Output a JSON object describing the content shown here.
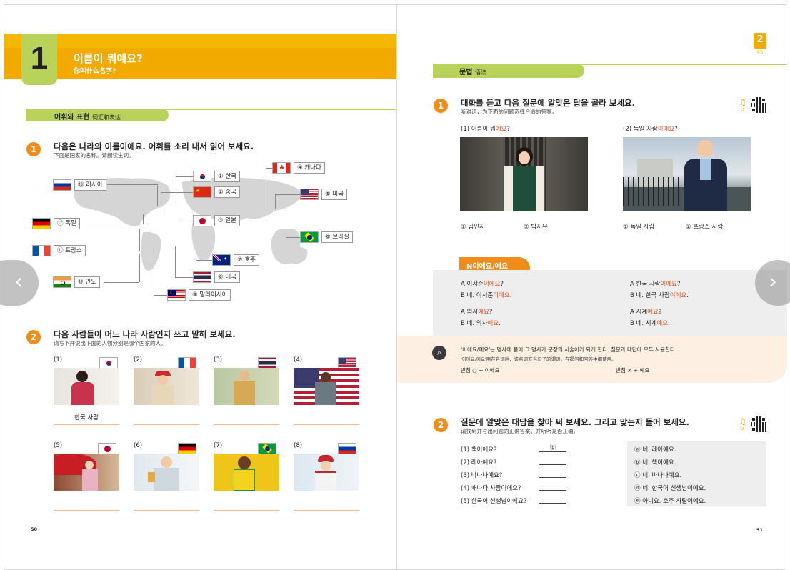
{
  "left_page": {
    "chapter_number": "1",
    "chapter_title": "이름이 뭐예요?",
    "chapter_subtitle": "你叫什么名字?",
    "section_title": "어휘와 표현",
    "section_subtitle": "词汇和表达",
    "q1": {
      "number": "1",
      "title": "다음은 나라의 이름이에요. 어휘를 소리 내서 읽어 보세요.",
      "subtitle": "下面是国家的名称。请朗读生词。",
      "countries": [
        {
          "label": "① 한국",
          "flag": "korea"
        },
        {
          "label": "② 중국",
          "flag": "china"
        },
        {
          "label": "③ 일본",
          "flag": "japan"
        },
        {
          "label": "④ 캐나다",
          "flag": "canada"
        },
        {
          "label": "⑤ 미국",
          "flag": "usa"
        },
        {
          "label": "⑥ 브라질",
          "flag": "brazil"
        },
        {
          "label": "⑦ 호주",
          "flag": "australia"
        },
        {
          "label": "⑧ 태국",
          "flag": "thailand"
        },
        {
          "label": "⑨ 말레이시아",
          "flag": "malaysia"
        },
        {
          "label": "⑩ 인도",
          "flag": "india"
        },
        {
          "label": "⑪ 프랑스",
          "flag": "france"
        },
        {
          "label": "⑫ 독일",
          "flag": "germany"
        },
        {
          "label": "⑬ 러시아",
          "flag": "russia"
        }
      ]
    },
    "q2": {
      "number": "2",
      "title": "다음 사람들이 어느 나라 사람인지 쓰고 말해 보세요.",
      "subtitle": "请写下并说出下面的人物分别是哪个国家的人。",
      "items": [
        {
          "label": "(1)",
          "flag": "korea",
          "answer": "한국 사람"
        },
        {
          "label": "(2)",
          "flag": "france",
          "answer": ""
        },
        {
          "label": "(3)",
          "flag": "thailand",
          "answer": ""
        },
        {
          "label": "(4)",
          "flag": "usa",
          "answer": ""
        },
        {
          "label": "(5)",
          "flag": "japan",
          "answer": ""
        },
        {
          "label": "(6)",
          "flag": "germany",
          "answer": ""
        },
        {
          "label": "(7)",
          "flag": "brazil",
          "answer": ""
        },
        {
          "label": "(8)",
          "flag": "russia",
          "answer": ""
        }
      ]
    },
    "page_number": "50"
  },
  "right_page": {
    "chapter_tab_number": "2",
    "chapter_tab_label": "문법",
    "section_title": "문법",
    "section_subtitle": "语法",
    "q1": {
      "number": "1",
      "title": "대화를 듣고 다음 질문에 알맞은 답을 골라 보세요.",
      "subtitle": "听对话，为下面的问题选择合适的答案。",
      "track": "17",
      "questions": [
        {
          "prefix": "(1) 이름이 뭐",
          "highlight": "예요",
          "suffix": "?",
          "options": [
            "① 김민지",
            "② 박지유"
          ]
        },
        {
          "prefix": "(2) 독일 사람",
          "highlight": "이에요",
          "suffix": "?",
          "options": [
            "① 독일 사람",
            "② 프랑스 사람"
          ]
        }
      ]
    },
    "grammar": {
      "tab_label": "N이에요/예요",
      "examples": [
        {
          "a_prefix": "A  이서준",
          "a_hl": "이에요",
          "a_suffix": "?",
          "b_prefix": "B  네. 이서준",
          "b_hl": "이에요",
          "b_suffix": "."
        },
        {
          "a_prefix": "A  한국 사람",
          "a_hl": "이에요",
          "a_suffix": "?",
          "b_prefix": "B  네. 한국 사람",
          "b_hl": "이에요",
          "b_suffix": "."
        },
        {
          "a_prefix": "A  의사",
          "a_hl": "예요",
          "a_suffix": "?",
          "b_prefix": "B  네. 의사",
          "b_hl": "예요",
          "b_suffix": "."
        },
        {
          "a_prefix": "A  시계",
          "a_hl": "예요",
          "a_suffix": "?",
          "b_prefix": "B  네. 시계",
          "b_hl": "예요",
          "b_suffix": "."
        }
      ],
      "note_line1": "'이에요/예요'는 명사에 붙어 그 명사가 문장의 서술어가 되게 한다. 질문과 대답에 모두 사용한다.",
      "note_line2": "'이에요/예요'用在名词后，该名词充当句子的谓语。在提问和回答中都使用。",
      "rule_left": "받침 ○ + 이에요",
      "rule_right": "받침 × + 예요"
    },
    "q2": {
      "number": "2",
      "title": "질문에 알맞은 대답을 찾아 써 보세요. 그리고 맞는지 들어 보세요.",
      "subtitle": "请找到并写出问题的正确答案。并听听是否正确。",
      "track": "18",
      "questions": [
        {
          "q": "(1) 책이에요?",
          "answer": "ⓑ"
        },
        {
          "q": "(2) 레아예요?",
          "answer": ""
        },
        {
          "q": "(3) 바나나예요?",
          "answer": ""
        },
        {
          "q": "(4) 캐나다 사람이에요?",
          "answer": ""
        },
        {
          "q": "(5) 한국어 선생님이에요?",
          "answer": ""
        }
      ],
      "choices": [
        "ⓐ 네. 레아예요.",
        "ⓑ 네. 책이에요.",
        "ⓒ 네. 바나나예요.",
        "ⓓ 네. 한국어 선생님이에요.",
        "ⓔ 아니요. 호주 사람이에요."
      ]
    },
    "page_number": "51"
  },
  "nav": {
    "prev": "‹",
    "next": "›"
  },
  "colors": {
    "orange": "#f2a900",
    "green": "#b9d35a",
    "accent": "#f08c1a",
    "highlight": "#e8541e",
    "grammar_bg": "#eeeeee",
    "note_bg": "#fdf0e3"
  }
}
